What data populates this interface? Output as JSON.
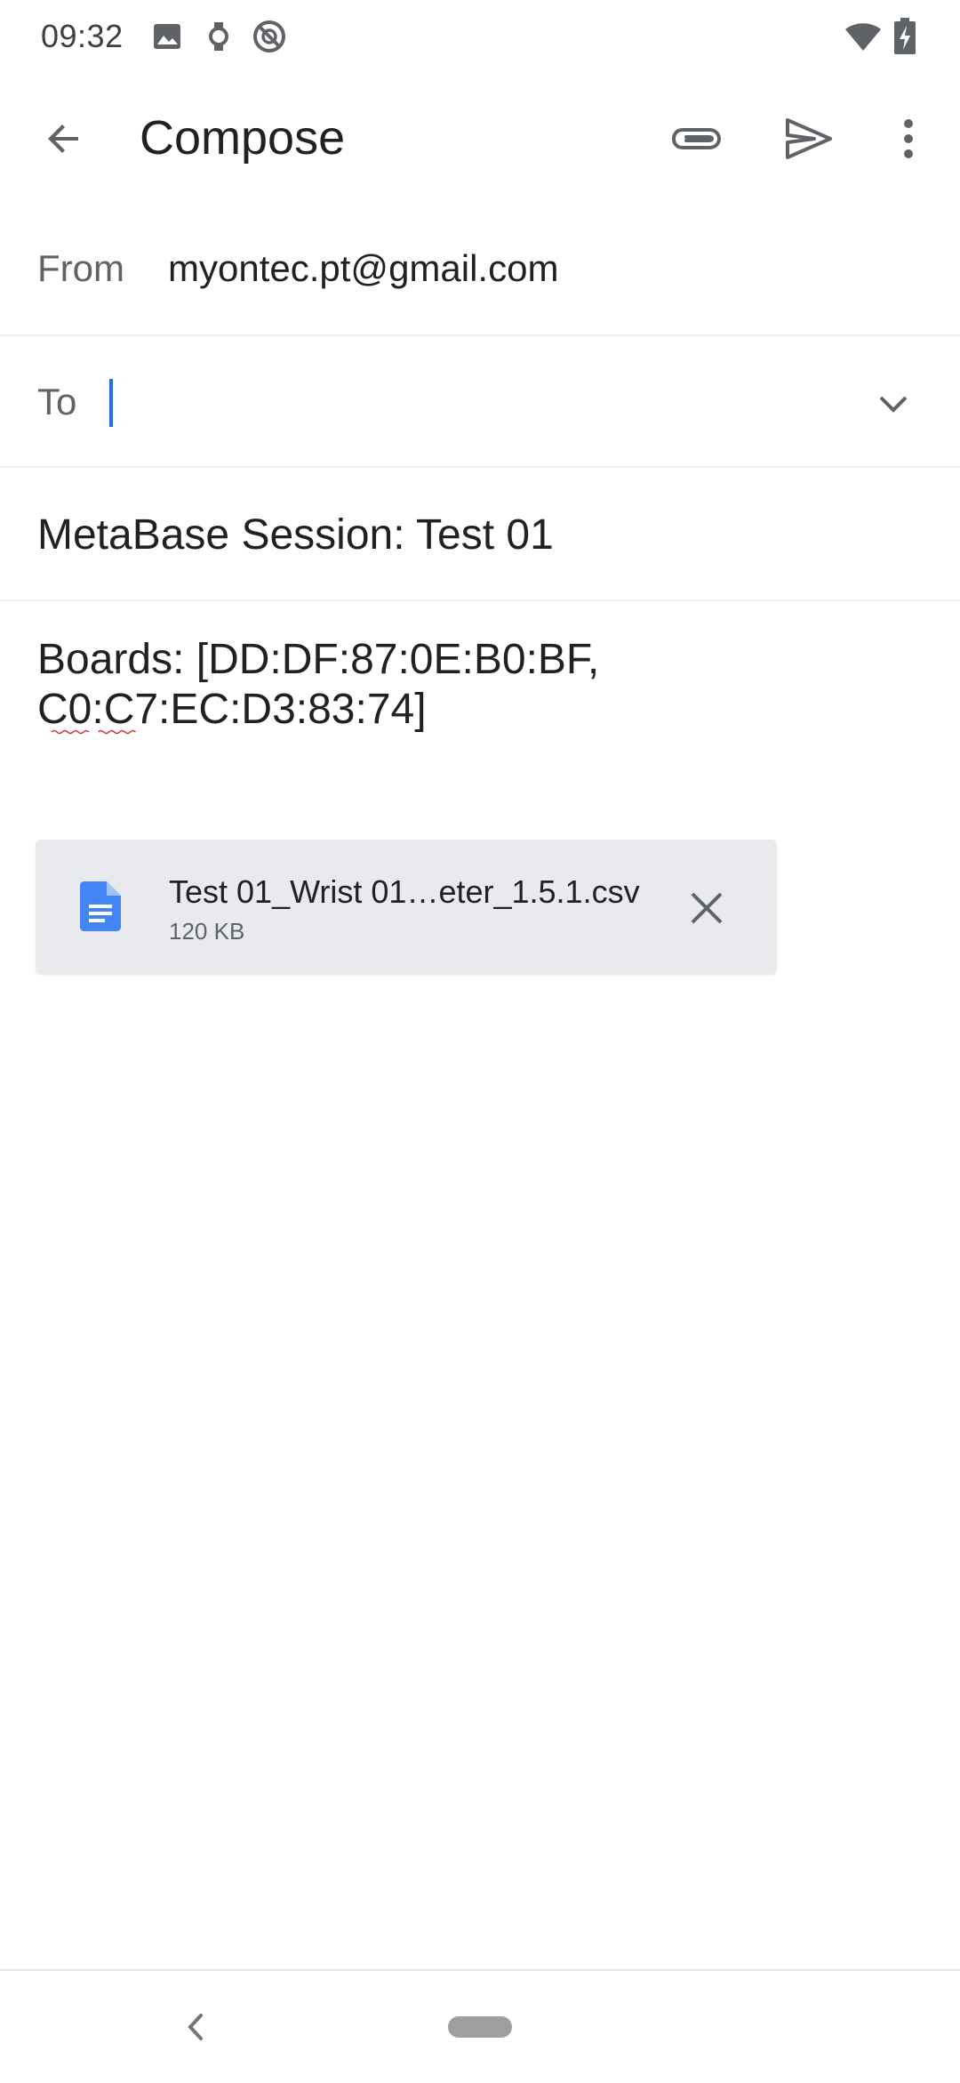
{
  "status_bar": {
    "time": "09:32",
    "icons": [
      "image-icon",
      "watch-icon",
      "do-not-disturb-icon",
      "wifi-icon",
      "battery-charging-icon"
    ]
  },
  "toolbar": {
    "title": "Compose",
    "back_icon": "arrow-back-icon",
    "attach_icon": "paperclip-icon",
    "send_icon": "send-icon",
    "more_icon": "more-vert-icon"
  },
  "from": {
    "label": "From",
    "value": "myontec.pt@gmail.com"
  },
  "to": {
    "label": "To",
    "value": "",
    "expand_icon": "chevron-down-icon"
  },
  "subject": {
    "value": "MetaBase Session: Test 01"
  },
  "body": {
    "text": "Boards: [DD:DF:87:0E:B0:BF,\nC0:C7:EC:D3:83:74]"
  },
  "attachment": {
    "file_name": "Test 01_Wrist 01…eter_1.5.1.csv",
    "file_size": "120 KB",
    "icon": "document-icon",
    "remove_icon": "close-icon"
  },
  "nav_bar": {
    "back_icon": "nav-back-icon",
    "home_icon": "home-pill-icon"
  },
  "colors": {
    "accent": "#1a73e8",
    "doc_icon": "#4285f4",
    "attachment_bg": "#e8eaed",
    "label_gray": "#5f6368",
    "spellcheck": "#d93025"
  }
}
